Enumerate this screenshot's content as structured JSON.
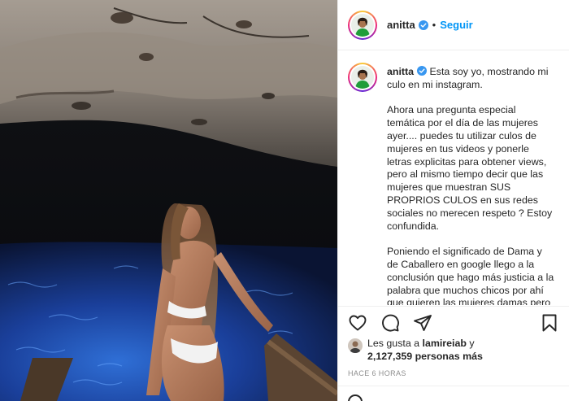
{
  "post": {
    "username": "anitta",
    "follow_label": "Seguir",
    "separator": "•",
    "caption_user": "anitta",
    "caption_text": " Esta soy yo, mostrando mi culo en mi instagram.\n\nAhora una pregunta especial temática por el día de las mujeres ayer.... puedes tu utilizar culos de mujeres en tus videos y ponerle letras explicitas para obtener views, pero al mismo tiempo decir que las mujeres que muestran SUS PROPRIOS CULOS en sus redes sociales no merecen respeto ? Estoy confundida.\n\nPoniendo el significado de Dama y de Caballero en google llego a la conclusión que hago más justicia a la palabra que muchos chicos por ahí que quieren las mujeres damas pero no tienen nada de caballero",
    "likes_prefix": "Les gusta a ",
    "likes_user": "lamireiab",
    "likes_and": " y",
    "likes_count": "2,127,359 personas más",
    "timestamp": "HACE 6 HORAS"
  },
  "icons": {
    "like": "heart-icon",
    "comment": "comment-icon",
    "share": "share-icon",
    "save": "bookmark-icon",
    "verified": "verified-badge-icon"
  },
  "colors": {
    "accent": "#0095f6",
    "verified": "#3897f0",
    "text": "#262626",
    "muted": "#8e8e8e",
    "border": "#efefef"
  }
}
